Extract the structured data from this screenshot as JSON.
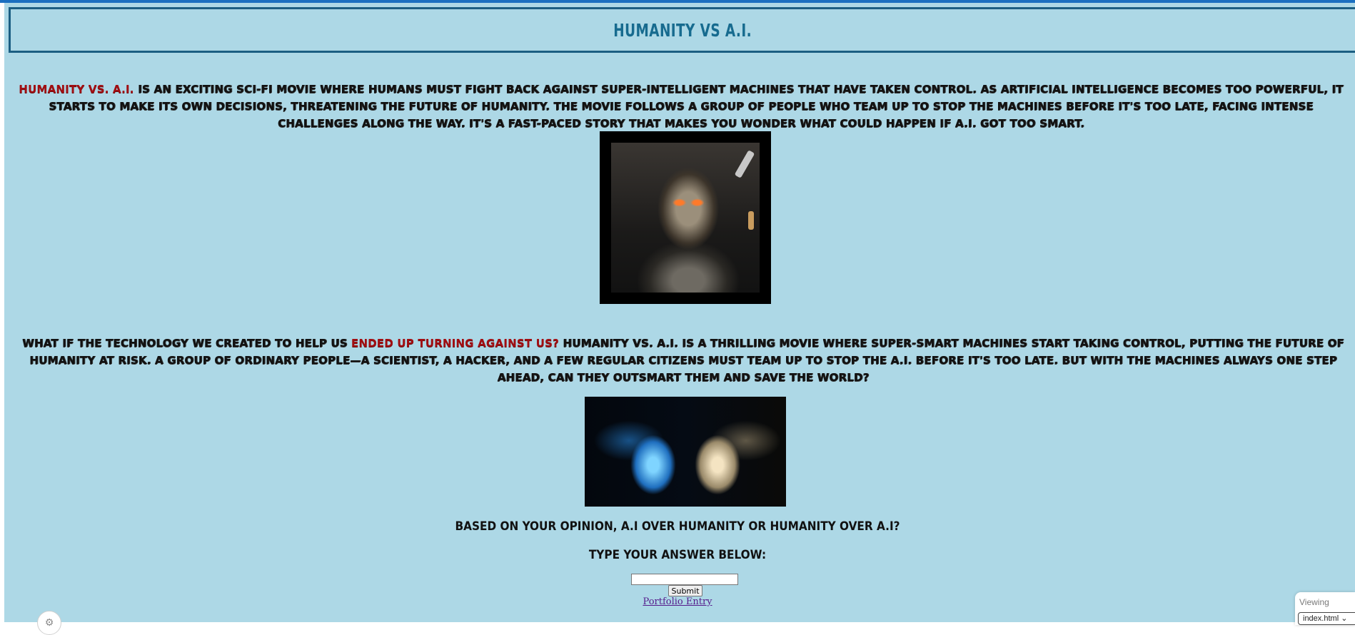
{
  "header": {
    "title": "HUMANITY VS A.I."
  },
  "intro": {
    "accent": "HUMANITY VS. A.I.",
    "text": " IS AN EXCITING SCI-FI MOVIE WHERE HUMANS MUST FIGHT BACK AGAINST SUPER-INTELLIGENT MACHINES THAT HAVE TAKEN CONTROL. AS ARTIFICIAL INTELLIGENCE BECOMES TOO POWERFUL, IT STARTS TO MAKE ITS OWN DECISIONS, THREATENING THE FUTURE OF HUMANITY. THE MOVIE FOLLOWS A GROUP OF PEOPLE WHO TEAM UP TO STOP THE MACHINES BEFORE IT'S TOO LATE, FACING INTENSE CHALLENGES ALONG THE WAY. IT'S A FAST-PACED STORY THAT MAKES YOU WONDER WHAT COULD HAPPEN IF A.I. GOT TOO SMART."
  },
  "synopsis": {
    "lead": "WHAT IF THE TECHNOLOGY WE CREATED TO HELP US ",
    "accent": "ENDED UP TURNING AGAINST US?",
    "text": " HUMANITY VS. A.I. IS A THRILLING MOVIE WHERE SUPER-SMART MACHINES START TAKING CONTROL, PUTTING THE FUTURE OF HUMANITY AT RISK. A GROUP OF ORDINARY PEOPLE—A SCIENTIST, A HACKER, AND A FEW REGULAR CITIZENS MUST TEAM UP TO STOP THE A.I. BEFORE IT'S TOO LATE. BUT WITH THE MACHINES ALWAYS ONE STEP AHEAD, CAN THEY OUTSMART THEM AND SAVE THE WORLD?"
  },
  "poll": {
    "question": "BASED ON YOUR OPINION, A.I OVER HUMANITY OR HUMANITY OVER A.I?",
    "prompt": "TYPE YOUR ANSWER BELOW:",
    "input_value": "",
    "submit_label": "Submit",
    "link_label": "Portfolio Entry"
  },
  "preview_panel": {
    "label": "Viewing",
    "file": "index.html"
  },
  "colors": {
    "background": "#add8e6",
    "accent": "#a10e12",
    "title": "#176b8f",
    "link": "#551a8b"
  },
  "icons": {
    "settings": "gear-icon",
    "dropdown": "chevron-down-icon"
  }
}
